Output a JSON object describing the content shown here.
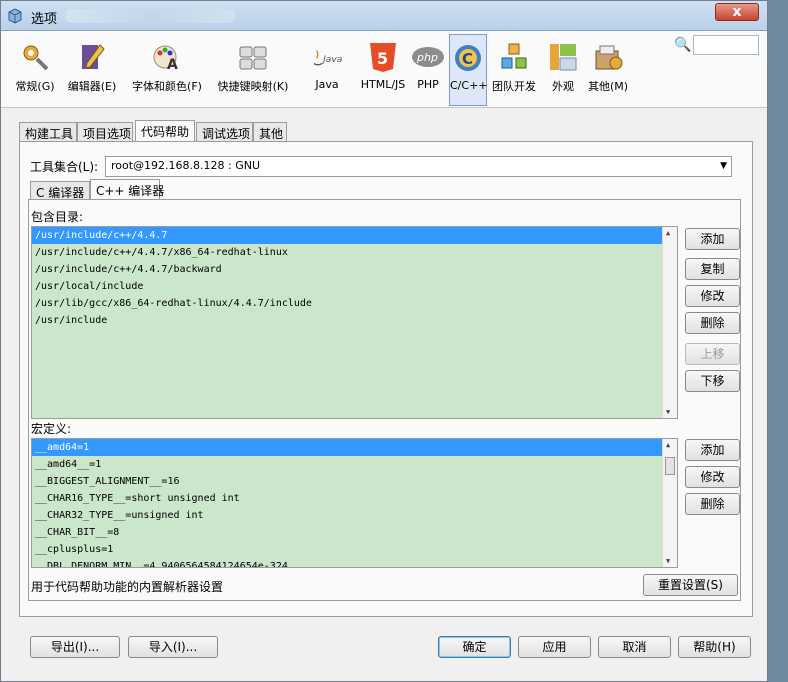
{
  "window": {
    "title": "选项",
    "close_label": "x"
  },
  "toolbar": {
    "categories": [
      {
        "label": "常规(G)",
        "icon": "gear-wrench-icon"
      },
      {
        "label": "编辑器(E)",
        "icon": "pencil-book-icon"
      },
      {
        "label": "字体和颜色(F)",
        "icon": "palette-font-icon"
      },
      {
        "label": "快捷键映射(K)",
        "icon": "keyboard-icon"
      },
      {
        "label": "Java",
        "icon": "java-icon"
      },
      {
        "label": "HTML/JS",
        "icon": "html5-icon"
      },
      {
        "label": "PHP",
        "icon": "php-icon"
      },
      {
        "label": "C/C++",
        "icon": "c-cpp-icon"
      },
      {
        "label": "团队开发",
        "icon": "team-cubes-icon"
      },
      {
        "label": "外观",
        "icon": "appearance-icon"
      },
      {
        "label": "其他(M)",
        "icon": "misc-icon"
      }
    ],
    "active": "C/C++",
    "icon_text": {
      "java": "Java",
      "html5": "5",
      "php": "php",
      "c": "C"
    },
    "search_value": ""
  },
  "main_tabs": [
    "构建工具",
    "项目选项",
    "代码帮助",
    "调试选项",
    "其他"
  ],
  "active_main_tab": "代码帮助",
  "tool_collection": {
    "label": "工具集合(L):",
    "value": "root@192.168.8.128 : GNU"
  },
  "sub_tabs": [
    "C 编译器",
    "C++ 编译器"
  ],
  "active_sub_tab": "C++ 编译器",
  "include": {
    "label": "包含目录:",
    "items": [
      "/usr/include/c++/4.4.7",
      "/usr/include/c++/4.4.7/x86_64-redhat-linux",
      "/usr/include/c++/4.4.7/backward",
      "/usr/local/include",
      "/usr/lib/gcc/x86_64-redhat-linux/4.4.7/include",
      "/usr/include"
    ],
    "buttons": {
      "add": "添加",
      "copy": "复制",
      "edit": "修改",
      "delete": "删除",
      "up": "上移",
      "down": "下移"
    }
  },
  "macros": {
    "label": "宏定义:",
    "items": [
      "__amd64=1",
      "__amd64__=1",
      "__BIGGEST_ALIGNMENT__=16",
      "__CHAR16_TYPE__=short unsigned int",
      "__CHAR32_TYPE__=unsigned int",
      "__CHAR_BIT__=8",
      "__cplusplus=1",
      "__DBL_DENORM_MIN__=4.9406564584124654e-324"
    ],
    "buttons": {
      "add": "添加",
      "edit": "修改",
      "delete": "删除"
    }
  },
  "note": "用于代码帮助功能的内置解析器设置",
  "reset_button": "重置设置(S)",
  "footer": {
    "export": "导出(I)...",
    "import": "导入(I)...",
    "ok": "确定",
    "apply": "应用",
    "cancel": "取消",
    "help": "帮助(H)"
  },
  "colors": {
    "accent": "#3399ff",
    "list_bg": "#cbe6cb",
    "active_cat": "#dde7f7"
  }
}
